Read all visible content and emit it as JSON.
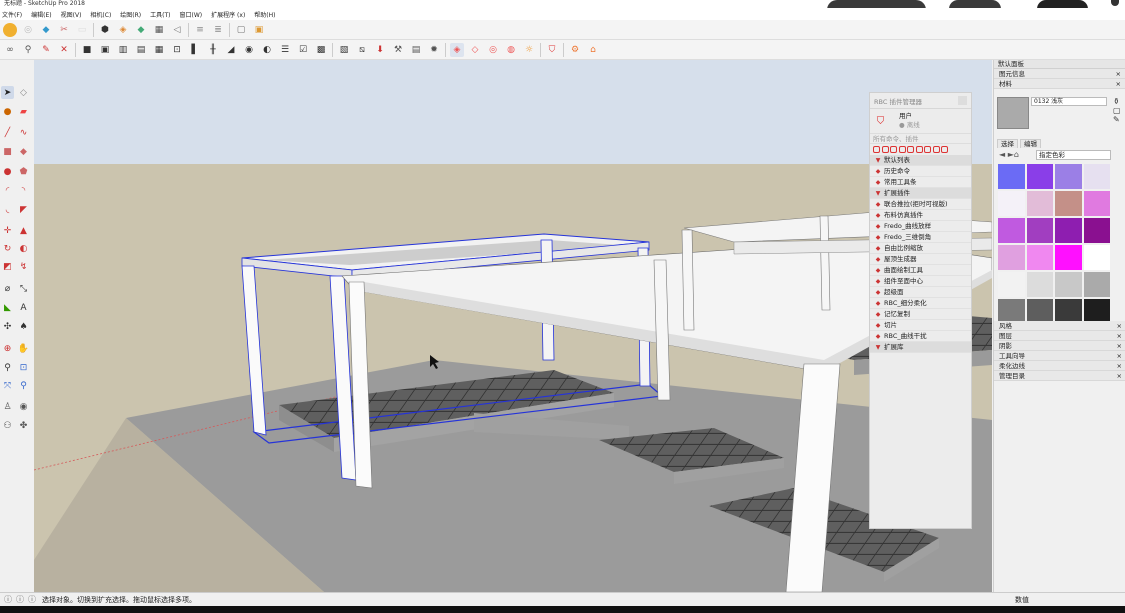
{
  "window": {
    "title": "无标题 - SketchUp Pro 2018"
  },
  "menu": [
    "文件(F)",
    "编辑(E)",
    "视图(V)",
    "相机(C)",
    "绘图(R)",
    "工具(T)",
    "窗口(W)",
    "扩展程序 (x)",
    "帮助(H)"
  ],
  "rbc_panel": {
    "title": "RBC 插件管理器",
    "user_label": "用户",
    "user_sub": "● 离线",
    "search_placeholder": "所有命令、插件",
    "items": [
      {
        "label": "默认列表",
        "kind": "section"
      },
      {
        "label": "历史命令",
        "kind": "item",
        "icon": "history-icon"
      },
      {
        "label": "常用工具条",
        "kind": "item",
        "icon": "star-icon"
      },
      {
        "label": "扩展插件",
        "kind": "section"
      },
      {
        "label": "联合推拉(拒时可视版)",
        "kind": "item",
        "icon": "push-icon"
      },
      {
        "label": "布料仿真插件",
        "kind": "item",
        "icon": "cloth-icon"
      },
      {
        "label": "Fredo_曲线放样",
        "kind": "item",
        "icon": "curve-icon"
      },
      {
        "label": "Fredo_三维倒角",
        "kind": "item",
        "icon": "bevel-icon"
      },
      {
        "label": "自由比例缩放",
        "kind": "item",
        "icon": "scale-icon"
      },
      {
        "label": "屋顶生成器",
        "kind": "item",
        "icon": "roof-icon"
      },
      {
        "label": "曲面绘制工具",
        "kind": "item",
        "icon": "surface-icon"
      },
      {
        "label": "组件至面中心",
        "kind": "item",
        "icon": "center-icon"
      },
      {
        "label": "超级面",
        "kind": "item",
        "icon": "face-icon"
      },
      {
        "label": "RBC_细分柔化",
        "kind": "item",
        "icon": "subdivide-icon"
      },
      {
        "label": "记忆复制",
        "kind": "item",
        "icon": "copy-icon"
      },
      {
        "label": "切片",
        "kind": "item",
        "icon": "slice-icon"
      },
      {
        "label": "RBC_曲线干扰",
        "kind": "item",
        "icon": "curve-noise-icon"
      },
      {
        "label": "扩展库",
        "kind": "section"
      }
    ]
  },
  "right_panel": {
    "title": "默认面板",
    "entity_info": "图元信息",
    "materials": "材料",
    "material_name": "0132 浅灰",
    "tab_select": "选择",
    "tab_edit": "编辑",
    "library": "指定色彩",
    "swatches": [
      "#6b6bf5",
      "#8a3ee8",
      "#9b7fe6",
      "#e6e0f0",
      "#f4f1f8",
      "#e2bcd8",
      "#c49088",
      "#e07ae0",
      "#c05ae0",
      "#a13ec0",
      "#8e1eb0",
      "#8a1090",
      "#e0a0e0",
      "#f088f0",
      "#ff10ff",
      "#ffffff",
      "#f2f2f2",
      "#dcdcdc",
      "#c8c8c8",
      "#aaaaaa",
      "#7a7a7a",
      "#5e5e5e",
      "#3a3a3a",
      "#1e1e1e"
    ],
    "collapsed": [
      "风格",
      "图层",
      "阴影",
      "工具向导",
      "柔化边线",
      "管理目录"
    ]
  },
  "status": {
    "text": "选择对象。切换到扩充选择。拖动鼠标选择多项。",
    "measure_label": "数值"
  }
}
